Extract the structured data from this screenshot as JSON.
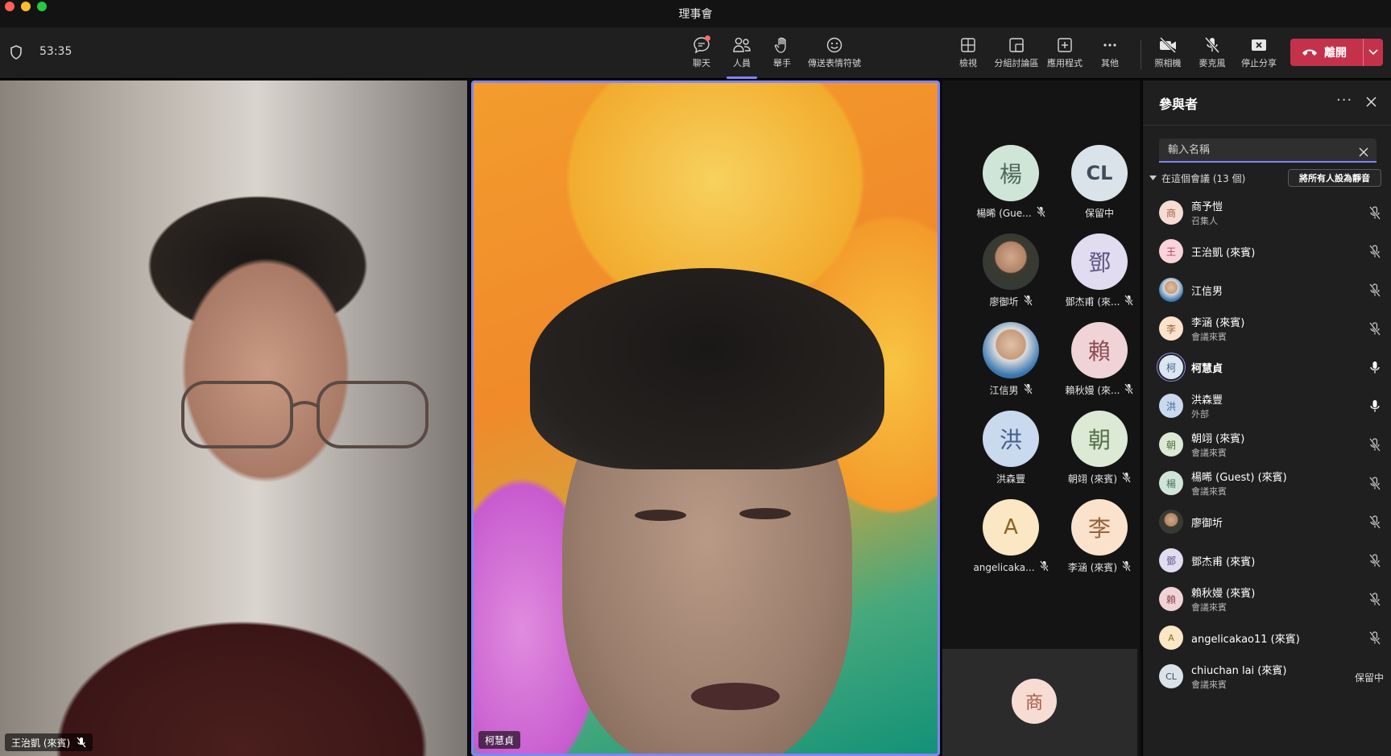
{
  "window": {
    "title": "理事會"
  },
  "toolbar": {
    "timer": "53:35",
    "buttons": [
      {
        "label": "聊天",
        "icon": "chat-icon"
      },
      {
        "label": "人員",
        "icon": "people-icon",
        "active": true
      },
      {
        "label": "舉手",
        "icon": "raise-hand-icon"
      },
      {
        "label": "傳送表情符號",
        "icon": "emoji-icon"
      },
      {
        "label": "檢視",
        "icon": "view-icon"
      },
      {
        "label": "分組討論區",
        "icon": "breakout-rooms-icon"
      },
      {
        "label": "應用程式",
        "icon": "apps-icon"
      },
      {
        "label": "其他",
        "icon": "more-icon"
      },
      {
        "label": "照相機",
        "icon": "camera-off-icon"
      },
      {
        "label": "麥克風",
        "icon": "mic-off-icon"
      },
      {
        "label": "停止分享",
        "icon": "stop-share-icon"
      }
    ],
    "leave_label": "離開",
    "accent": "#7f85f5",
    "leave_color": "#c4314b"
  },
  "videos": {
    "left": {
      "name": "王治凱 (來賓)",
      "muted": true
    },
    "center": {
      "name": "柯慧貞",
      "speaking": true
    }
  },
  "tiles": [
    {
      "initial": "楊",
      "label": "楊晞 (Gue...",
      "bg": "#cfe5d8",
      "fg": "#4e6a5a",
      "muted": true
    },
    {
      "initial": "CL",
      "label": "保留中",
      "bg": "#dbe3ea",
      "fg": "#3f4d5a",
      "muted": false
    },
    {
      "initial": "",
      "label": "廖御圻",
      "photo": true,
      "muted": true
    },
    {
      "initial": "鄧",
      "label": "鄧杰甫 (來...",
      "bg": "#e1dcf0",
      "fg": "#5d5580",
      "muted": true
    },
    {
      "initial": "",
      "label": "江信男",
      "photo": true,
      "muted": true
    },
    {
      "initial": "賴",
      "label": "賴秋嫚 (來...",
      "bg": "#efd3d6",
      "fg": "#8a4b53",
      "muted": true
    },
    {
      "initial": "洪",
      "label": "洪森豐",
      "bg": "#c9d9ee",
      "fg": "#44608a",
      "muted": false
    },
    {
      "initial": "朝",
      "label": "朝翊 (來賓)",
      "bg": "#dce9d4",
      "fg": "#55704a",
      "muted": true
    },
    {
      "initial": "A",
      "label": "angelicaka...",
      "bg": "#fbe7c4",
      "fg": "#8a6420",
      "muted": true
    },
    {
      "initial": "李",
      "label": "李涵 (來賓)",
      "bg": "#fbe2cc",
      "fg": "#96633a",
      "muted": true
    }
  ],
  "self_tile": {
    "initial": "商"
  },
  "panel": {
    "title": "參與者",
    "search_placeholder": "輸入名稱",
    "section_label": "在這個會議 (13 個)",
    "mute_all_label": "將所有人設為靜音",
    "participants": [
      {
        "initial": "商",
        "name": "商予愷",
        "sub": "召集人",
        "bg": "#f6dcd3",
        "fg": "#a45a44",
        "mic": "off"
      },
      {
        "initial": "王",
        "name": "王治凱 (來賓)",
        "sub": "",
        "bg": "#f8d3d9",
        "fg": "#b0465a",
        "mic": "off"
      },
      {
        "initial": "",
        "name": "江信男",
        "sub": "",
        "photo": true,
        "mic": "off"
      },
      {
        "initial": "李",
        "name": "李涵 (來賓)",
        "sub": "會議來賓",
        "bg": "#fbe2cc",
        "fg": "#96633a",
        "mic": "off"
      },
      {
        "initial": "柯",
        "name": "柯慧貞",
        "sub": "",
        "bg": "#dbe6f3",
        "fg": "#48607f",
        "mic": "on",
        "bold": true,
        "speaking": true
      },
      {
        "initial": "洪",
        "name": "洪森豐",
        "sub": "外部",
        "bg": "#c9d9ee",
        "fg": "#44608a",
        "mic": "on"
      },
      {
        "initial": "朝",
        "name": "朝翊 (來賓)",
        "sub": "會議來賓",
        "bg": "#dce9d4",
        "fg": "#55704a",
        "mic": "off"
      },
      {
        "initial": "楊",
        "name": "楊晞 (Guest) (來賓)",
        "sub": "會議來賓",
        "bg": "#cfe5d8",
        "fg": "#4e6a5a",
        "mic": "off"
      },
      {
        "initial": "",
        "name": "廖御圻",
        "sub": "",
        "photo": true,
        "mic": "off"
      },
      {
        "initial": "鄧",
        "name": "鄧杰甫 (來賓)",
        "sub": "",
        "bg": "#e1dcf0",
        "fg": "#5d5580",
        "mic": "off"
      },
      {
        "initial": "賴",
        "name": "賴秋嫚 (來賓)",
        "sub": "會議來賓",
        "bg": "#efd3d6",
        "fg": "#8a4b53",
        "mic": "off"
      },
      {
        "initial": "A",
        "name": "angelicakao11 (來賓)",
        "sub": "",
        "bg": "#fbe7c4",
        "fg": "#8a6420",
        "mic": "off"
      },
      {
        "initial": "CL",
        "name": "chiuchan lai (來賓)",
        "sub": "會議來賓",
        "bg": "#dbe3ea",
        "fg": "#3f4d5a",
        "status": "保留中"
      }
    ]
  }
}
